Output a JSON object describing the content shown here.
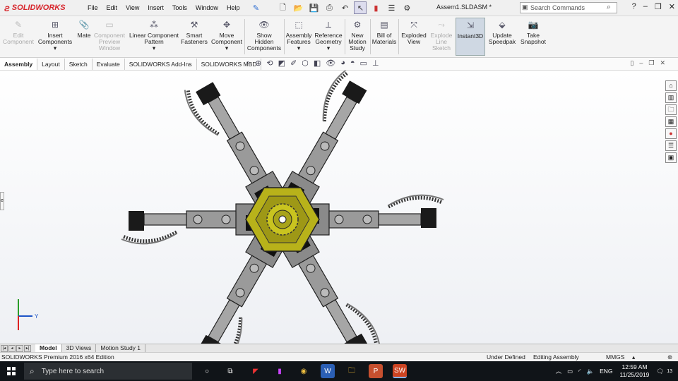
{
  "app": {
    "brand": "SOLIDWORKS",
    "document_title": "Assem1.SLDASM *",
    "search_placeholder": "Search Commands",
    "menus": [
      "File",
      "Edit",
      "View",
      "Insert",
      "Tools",
      "Window",
      "Help"
    ]
  },
  "ribbon": {
    "buttons": [
      {
        "label": "Edit\nComponent",
        "icon": "edit-component-icon",
        "enabled": false
      },
      {
        "label": "Insert\nComponents",
        "icon": "insert-components-icon",
        "enabled": true
      },
      {
        "label": "Mate",
        "icon": "mate-icon",
        "enabled": true
      },
      {
        "label": "Component\nPreview\nWindow",
        "icon": "preview-window-icon",
        "enabled": false
      },
      {
        "label": "Linear Component\nPattern",
        "icon": "linear-pattern-icon",
        "enabled": true
      },
      {
        "label": "Smart\nFasteners",
        "icon": "smart-fasteners-icon",
        "enabled": true
      },
      {
        "label": "Move\nComponent",
        "icon": "move-component-icon",
        "enabled": true
      },
      {
        "label": "Show\nHidden\nComponents",
        "icon": "show-hidden-icon",
        "enabled": true
      },
      {
        "label": "Assembly\nFeatures",
        "icon": "assembly-features-icon",
        "enabled": true
      },
      {
        "label": "Reference\nGeometry",
        "icon": "reference-geometry-icon",
        "enabled": true
      },
      {
        "label": "New\nMotion\nStudy",
        "icon": "motion-study-icon",
        "enabled": true
      },
      {
        "label": "Bill of\nMaterials",
        "icon": "bom-icon",
        "enabled": true
      },
      {
        "label": "Exploded\nView",
        "icon": "exploded-view-icon",
        "enabled": true
      },
      {
        "label": "Explode\nLine\nSketch",
        "icon": "explode-line-icon",
        "enabled": false
      },
      {
        "label": "Instant3D",
        "icon": "instant3d-icon",
        "enabled": true,
        "active": true
      },
      {
        "label": "Update\nSpeedpak",
        "icon": "speedpak-icon",
        "enabled": true
      },
      {
        "label": "Take\nSnapshot",
        "icon": "snapshot-icon",
        "enabled": true
      }
    ]
  },
  "tabs": [
    "Assembly",
    "Layout",
    "Sketch",
    "Evaluate",
    "SOLIDWORKS Add-Ins",
    "SOLIDWORKS MBD"
  ],
  "bottom_tabs": [
    "Model",
    "3D Views",
    "Motion Study 1"
  ],
  "status": {
    "edition": "SOLIDWORKS Premium 2016 x64 Edition",
    "definition": "Under Defined",
    "mode": "Editing Assembly",
    "units": "MMGS"
  },
  "taskbar": {
    "search_placeholder": "Type here to search",
    "language": "ENG",
    "time": "12:59 AM",
    "date": "11/25/2019",
    "notifications": "13"
  },
  "colors": {
    "brand_red": "#d7262c",
    "part_gray": "#8c8c8c",
    "hub_yellow": "#b8b21a",
    "taskbar": "#101418"
  }
}
